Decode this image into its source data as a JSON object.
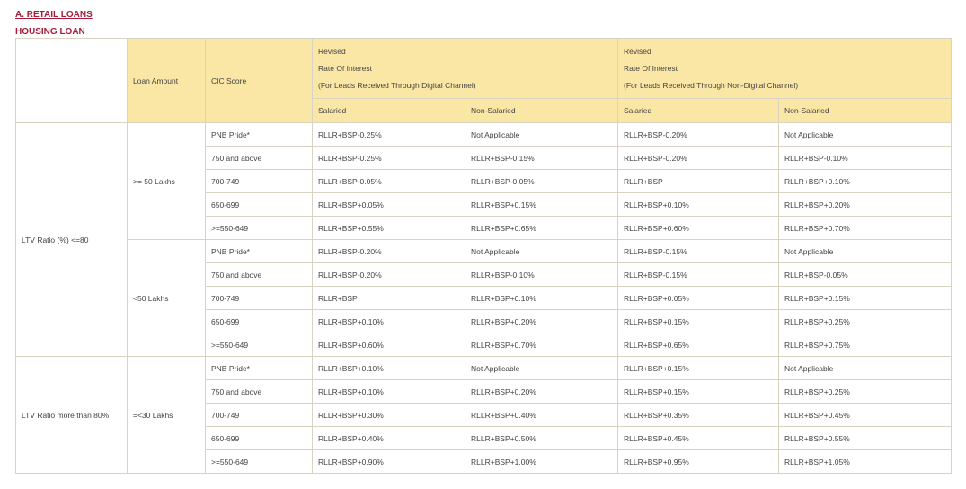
{
  "section_title": "A. RETAIL LOANS",
  "subsection_title": "HOUSING LOAN",
  "table": {
    "col_loan_amount": "Loan Amount",
    "col_cic_score": "CIC Score",
    "digital_group": [
      "Revised",
      "Rate Of Interest",
      "(For Leads Received Through Digital Channel)"
    ],
    "non_digital_group": [
      "Revised",
      "Rate Of Interest",
      "(For Leads Received Through Non-Digital Channel)"
    ],
    "subheaders": [
      "Salaried",
      "Non-Salaried",
      "Salaried",
      "Non-Salaried"
    ],
    "groups": [
      {
        "ltv": "LTV Ratio (%) <=80",
        "slabs": [
          {
            "amount": ">= 50 Lakhs",
            "rows": [
              [
                "PNB Pride*",
                "RLLR+BSP-0.25%",
                "Not Applicable",
                "RLLR+BSP-0.20%",
                "Not Applicable"
              ],
              [
                "750 and above",
                "RLLR+BSP-0.25%",
                "RLLR+BSP-0.15%",
                "RLLR+BSP-0.20%",
                "RLLR+BSP-0.10%"
              ],
              [
                "700-749",
                "RLLR+BSP-0.05%",
                "RLLR+BSP-0.05%",
                "RLLR+BSP",
                "RLLR+BSP+0.10%"
              ],
              [
                "650-699",
                "RLLR+BSP+0.05%",
                "RLLR+BSP+0.15%",
                "RLLR+BSP+0.10%",
                "RLLR+BSP+0.20%"
              ],
              [
                ">=550-649",
                "RLLR+BSP+0.55%",
                "RLLR+BSP+0.65%",
                "RLLR+BSP+0.60%",
                "RLLR+BSP+0.70%"
              ]
            ]
          },
          {
            "amount": "<50 Lakhs",
            "rows": [
              [
                "PNB Pride*",
                "RLLR+BSP-0.20%",
                "Not Applicable",
                "RLLR+BSP-0.15%",
                "Not Applicable"
              ],
              [
                "750 and above",
                "RLLR+BSP-0.20%",
                "RLLR+BSP-0.10%",
                "RLLR+BSP-0.15%",
                "RLLR+BSP-0.05%"
              ],
              [
                "700-749",
                "RLLR+BSP",
                "RLLR+BSP+0.10%",
                "RLLR+BSP+0.05%",
                "RLLR+BSP+0.15%"
              ],
              [
                "650-699",
                "RLLR+BSP+0.10%",
                "RLLR+BSP+0.20%",
                "RLLR+BSP+0.15%",
                "RLLR+BSP+0.25%"
              ],
              [
                ">=550-649",
                "RLLR+BSP+0.60%",
                "RLLR+BSP+0.70%",
                "RLLR+BSP+0.65%",
                "RLLR+BSP+0.75%"
              ]
            ]
          }
        ]
      },
      {
        "ltv": "LTV Ratio more than 80%",
        "slabs": [
          {
            "amount": "=<30 Lakhs",
            "rows": [
              [
                "PNB Pride*",
                "RLLR+BSP+0.10%",
                "Not Applicable",
                "RLLR+BSP+0.15%",
                "Not Applicable"
              ],
              [
                "750 and above",
                "RLLR+BSP+0.10%",
                "RLLR+BSP+0.20%",
                "RLLR+BSP+0.15%",
                "RLLR+BSP+0.25%"
              ],
              [
                "700-749",
                "RLLR+BSP+0.30%",
                "RLLR+BSP+0.40%",
                "RLLR+BSP+0.35%",
                "RLLR+BSP+0.45%"
              ],
              [
                "650-699",
                "RLLR+BSP+0.40%",
                "RLLR+BSP+0.50%",
                "RLLR+BSP+0.45%",
                "RLLR+BSP+0.55%"
              ],
              [
                ">=550-649",
                "RLLR+BSP+0.90%",
                "RLLR+BSP+1.00%",
                "RLLR+BSP+0.95%",
                "RLLR+BSP+1.05%"
              ]
            ]
          }
        ]
      }
    ]
  }
}
